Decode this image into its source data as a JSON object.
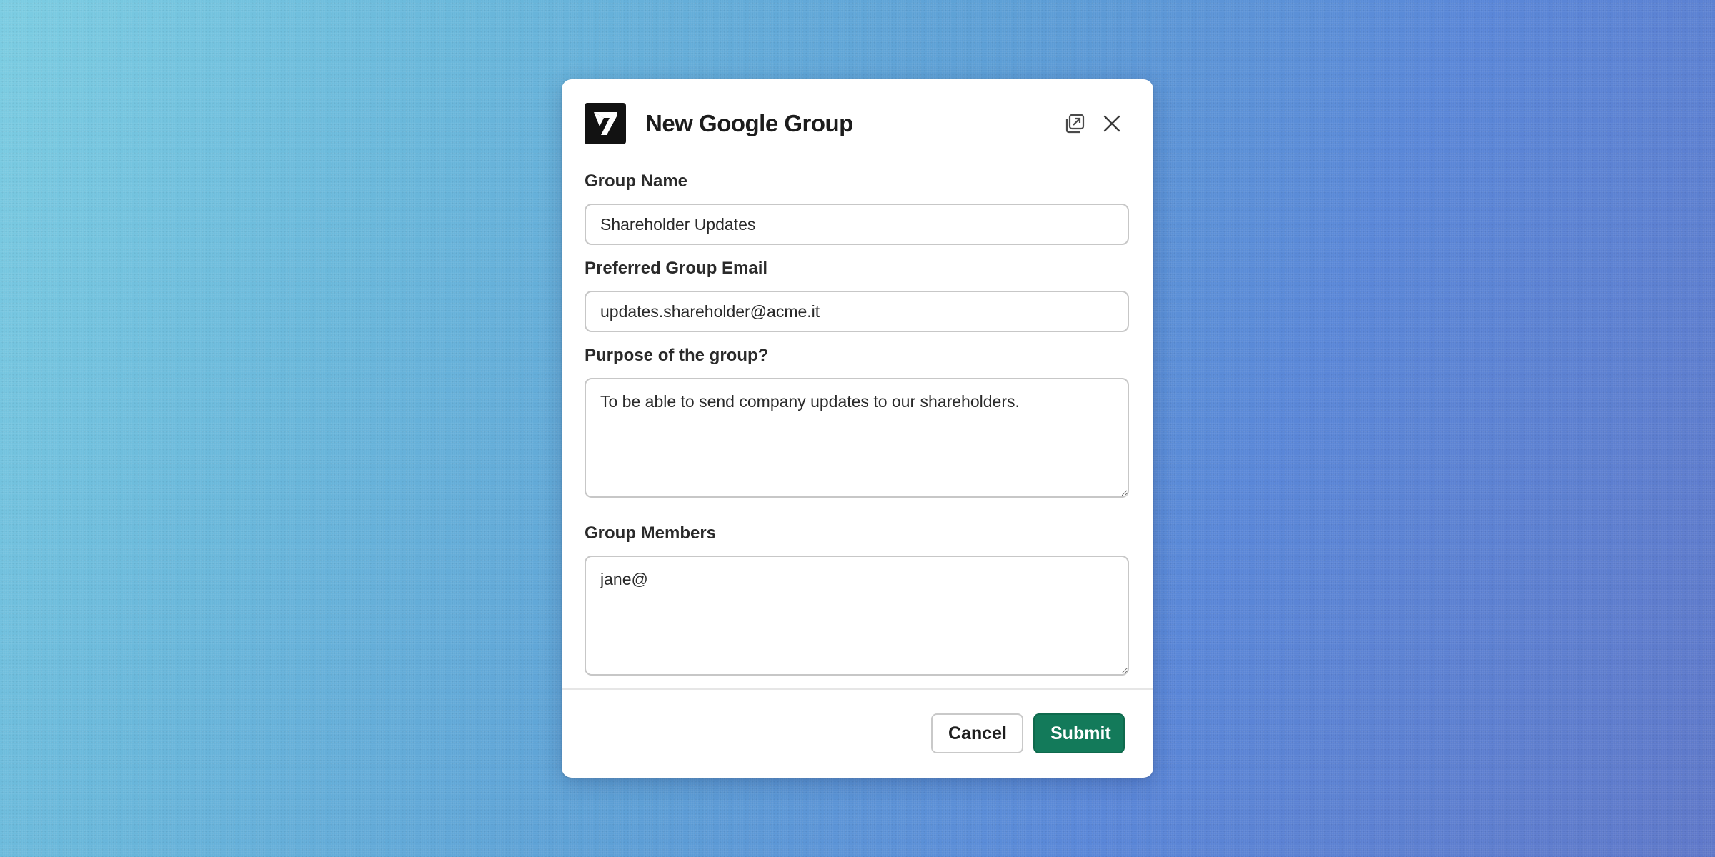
{
  "dialog": {
    "title": "New Google Group",
    "logo_icon": "app-logo-icon",
    "open_external_icon": "open-in-new-window-icon",
    "close_icon": "close-icon"
  },
  "form": {
    "group_name": {
      "label": "Group Name",
      "value": "Shareholder Updates"
    },
    "group_email": {
      "label": "Preferred Group Email",
      "value": "updates.shareholder@acme.it"
    },
    "purpose": {
      "label": "Purpose of the group?",
      "value": "To be able to send company updates to our shareholders."
    },
    "members": {
      "label": "Group Members",
      "value": "jane@"
    }
  },
  "footer": {
    "cancel_label": "Cancel",
    "submit_label": "Submit"
  },
  "colors": {
    "submit_bg": "#137a5a",
    "title_text": "#1c1c1c",
    "input_border": "#c7c7c7"
  }
}
